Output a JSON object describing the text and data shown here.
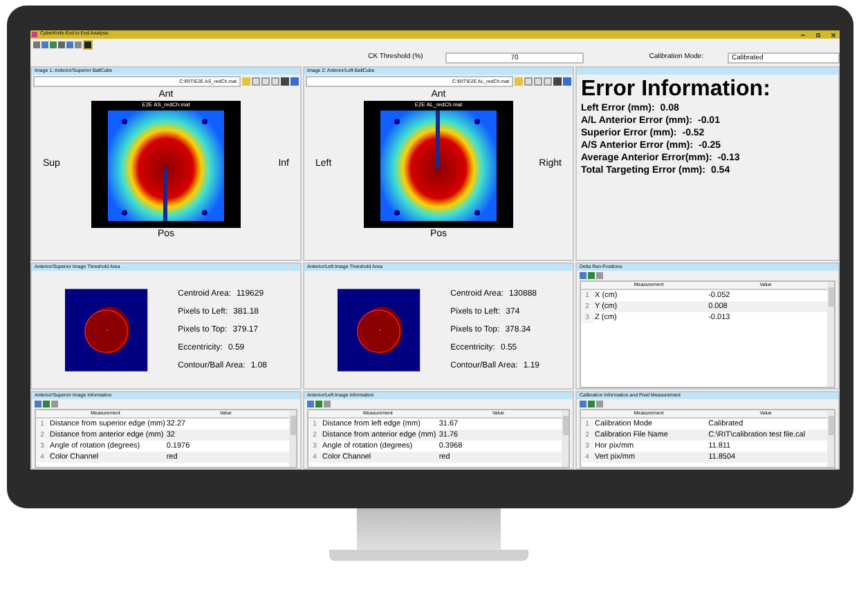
{
  "window": {
    "title": "CyberKnife End to End Analysis"
  },
  "threshold": {
    "label": "CK Threshold (%)",
    "value": "70"
  },
  "calibration_mode": {
    "label": "Calibration Mode:",
    "value": "Calibrated"
  },
  "images": [
    {
      "kind": "superior",
      "title": "Image 1: Anterior/Superior BallCube",
      "path": "C:\\RIT\\E2E AS_redCh.mat",
      "image_title": "E2E AS_redCh.mat",
      "top": "Ant",
      "bottom": "Pos",
      "left": "Sup",
      "right": "Inf"
    },
    {
      "kind": "left",
      "title": "Image 2: Anterior/Left BallCube",
      "path": "C:\\RIT\\E2E AL_redCh.mat",
      "image_title": "E2E AL_redCh.mat",
      "top": "Ant",
      "bottom": "Pos",
      "left": "Left",
      "right": "Right"
    }
  ],
  "error_info": {
    "title": "Error Information:",
    "lines": [
      {
        "label": "Left Error (mm):",
        "value": "0.08"
      },
      {
        "label": "A/L Anterior Error (mm):",
        "value": "-0.01"
      },
      {
        "label": "Superior Error (mm):",
        "value": "-0.52"
      },
      {
        "label": "A/S Anterior Error (mm):",
        "value": "-0.25"
      },
      {
        "label": "Average Anterior Error(mm):",
        "value": "-0.13"
      },
      {
        "label": "Total Targeting Error (mm):",
        "value": "0.54"
      }
    ]
  },
  "threshold_panels": [
    {
      "title": "Anterior/Superior Image Threshold Area",
      "stats": [
        {
          "label": "Centroid Area:",
          "value": "119629"
        },
        {
          "label": "Pixels to Left:",
          "value": "381.18"
        },
        {
          "label": "Pixels to Top:",
          "value": "379.17"
        },
        {
          "label": "Eccentricity:",
          "value": "0.59"
        },
        {
          "label": "Contour/Ball Area:",
          "value": "1.08"
        }
      ]
    },
    {
      "title": "Anterior/Left Image Threshold Area",
      "stats": [
        {
          "label": "Centroid Area:",
          "value": "130888"
        },
        {
          "label": "Pixels to Left:",
          "value": "374"
        },
        {
          "label": "Pixels to Top:",
          "value": "378.34"
        },
        {
          "label": "Eccentricity:",
          "value": "0.55"
        },
        {
          "label": "Contour/Ball Area:",
          "value": "1.19"
        }
      ]
    }
  ],
  "tables": [
    {
      "title": "Anterior/Superior Image Information",
      "columns": [
        "",
        "Measurement",
        "Value"
      ],
      "rows": [
        [
          "1",
          "Distance from superior edge (mm)",
          "32.27"
        ],
        [
          "2",
          "Distance from anterior edge (mm)",
          "32"
        ],
        [
          "3",
          "Angle of rotation (degrees)",
          "0.1976"
        ],
        [
          "4",
          "Color Channel",
          "red"
        ]
      ]
    },
    {
      "title": "Anterior/Left Image Information",
      "columns": [
        "",
        "Measurement",
        "Value"
      ],
      "rows": [
        [
          "1",
          "Distance from left edge (mm)",
          "31.67"
        ],
        [
          "2",
          "Distance from anterior edge (mm)",
          "31.76"
        ],
        [
          "3",
          "Angle of rotation (degrees)",
          "0.3968"
        ],
        [
          "4",
          "Color Channel",
          "red"
        ]
      ]
    },
    {
      "title": "Delta Ran Positions",
      "columns": [
        "",
        "Measurement",
        "Value"
      ],
      "rows": [
        [
          "1",
          "X (cm)",
          "-0.052"
        ],
        [
          "2",
          "Y (cm)",
          "0.008"
        ],
        [
          "3",
          "Z (cm)",
          "-0.013"
        ]
      ]
    },
    {
      "title": "Calibration Information and Pixel Measurement",
      "columns": [
        "",
        "Measurement",
        "Value"
      ],
      "rows": [
        [
          "1",
          "Calibration Mode",
          "Calibrated"
        ],
        [
          "2",
          "Calibration File Name",
          "C:\\RIT\\calibration test file.cal"
        ],
        [
          "3",
          "Hor pix/mm",
          "11.811"
        ],
        [
          "4",
          "Vert pix/mm",
          "11.8504"
        ]
      ]
    }
  ]
}
